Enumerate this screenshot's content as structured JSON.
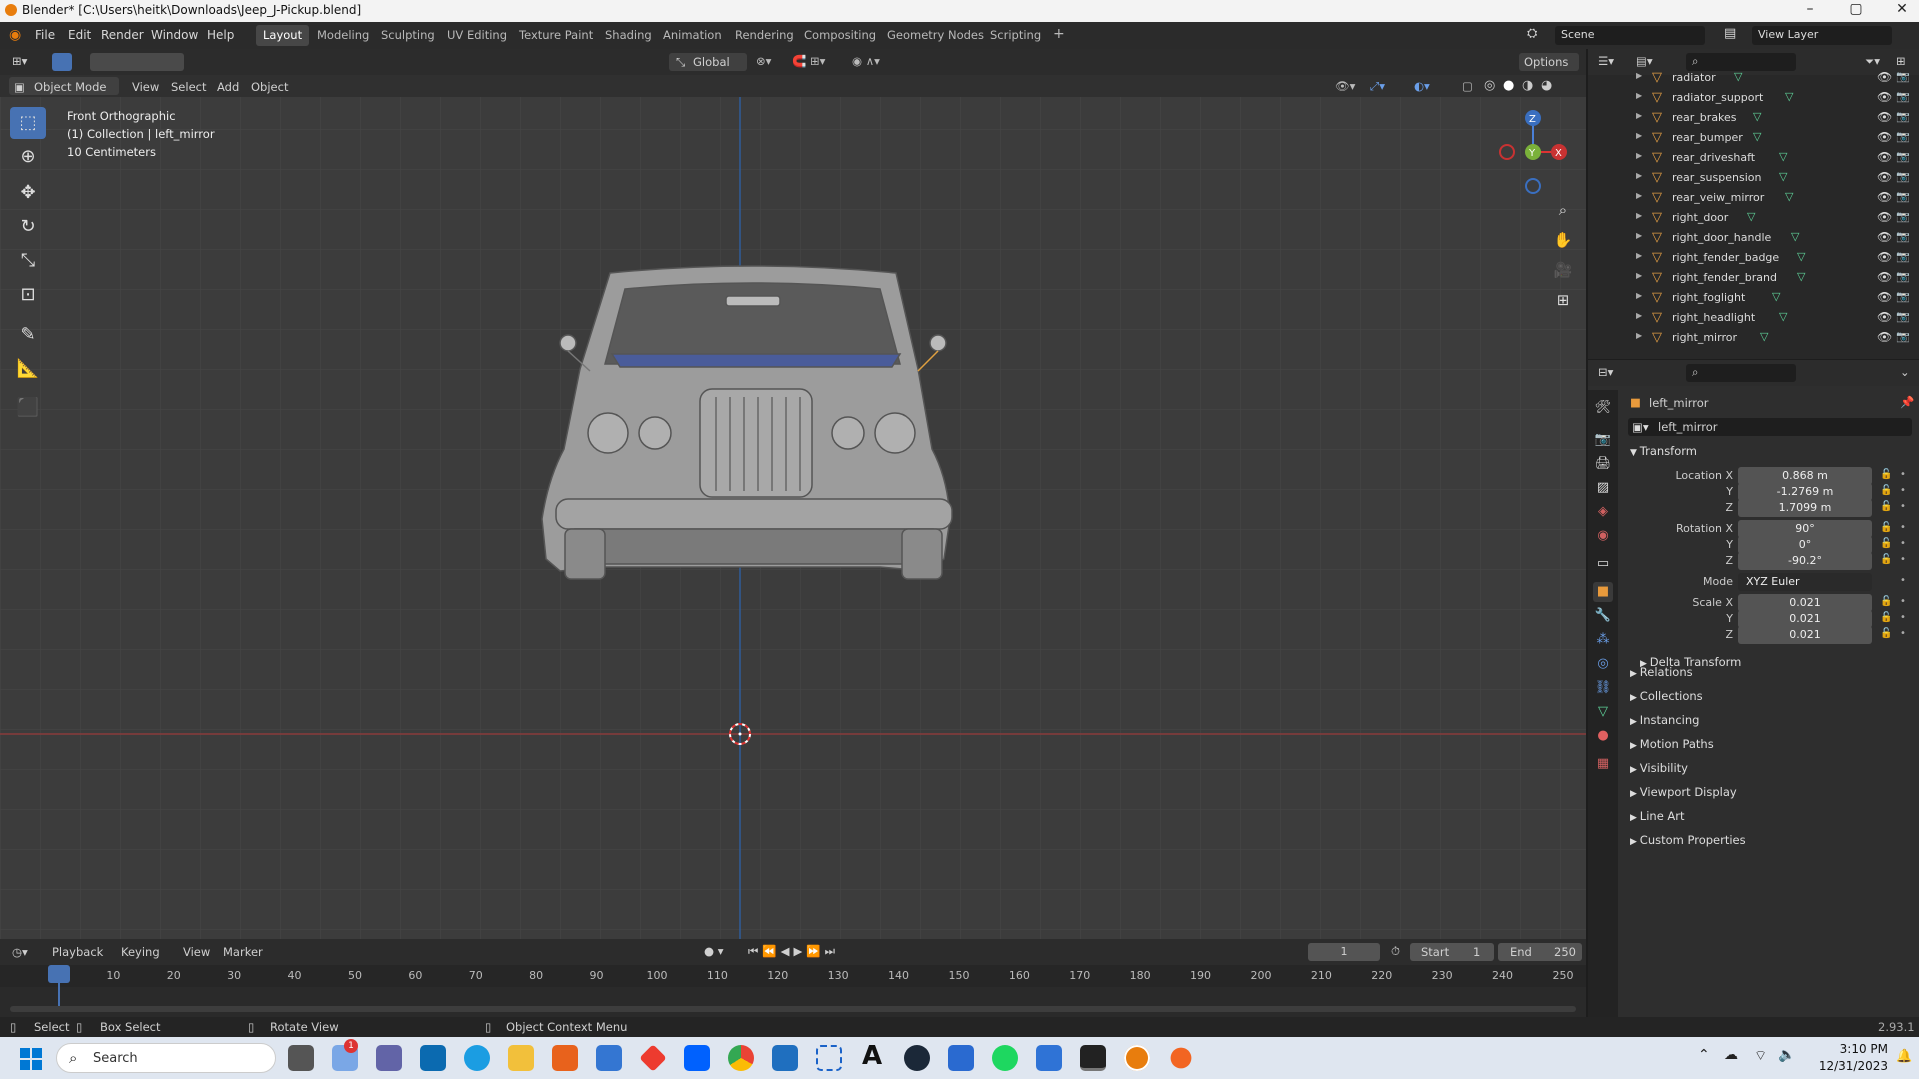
{
  "window": {
    "title": "Blender* [C:\\Users\\heitk\\Downloads\\Jeep_J-Pickup.blend]",
    "controls": [
      "–",
      "▢",
      "✕"
    ]
  },
  "menubar": {
    "menus": [
      "File",
      "Edit",
      "Render",
      "Window",
      "Help"
    ],
    "workspaces": [
      "Layout",
      "Modeling",
      "Sculpting",
      "UV Editing",
      "Texture Paint",
      "Shading",
      "Animation",
      "Rendering",
      "Compositing",
      "Geometry Nodes",
      "Scripting"
    ],
    "add_workspace": "+",
    "scene": "Scene",
    "view_layer": "View Layer"
  },
  "viewport": {
    "mode": "Object Mode",
    "menus": [
      "View",
      "Select",
      "Add",
      "Object"
    ],
    "orientation": "Global",
    "options": "Options",
    "overlay_lines": [
      "Front Orthographic",
      "(1) Collection | left_mirror",
      "10 Centimeters"
    ],
    "gizmo": {
      "z": "Z",
      "y": "Y",
      "x": "X"
    }
  },
  "outliner": {
    "items": [
      "radiator",
      "radiator_support",
      "rear_brakes",
      "rear_bumper",
      "rear_driveshaft",
      "rear_suspension",
      "rear_veiw_mirror",
      "right_door",
      "right_door_handle",
      "right_fender_badge",
      "right_fender_brand",
      "right_foglight",
      "right_headlight",
      "right_mirror"
    ]
  },
  "properties": {
    "object_name": "left_mirror",
    "datablock": "left_mirror",
    "transform_header": "Transform",
    "location_label": "Location X",
    "rotation_label": "Rotation X",
    "scale_label": "Scale X",
    "y_label": "Y",
    "z_label": "Z",
    "location": [
      "0.868 m",
      "-1.2769 m",
      "1.7099 m"
    ],
    "rotation": [
      "90°",
      "0°",
      "-90.2°"
    ],
    "mode_label": "Mode",
    "mode_value": "XYZ Euler",
    "scale": [
      "0.021",
      "0.021",
      "0.021"
    ],
    "delta": "Delta Transform",
    "sections": [
      "Relations",
      "Collections",
      "Instancing",
      "Motion Paths",
      "Visibility",
      "Viewport Display",
      "Line Art",
      "Custom Properties"
    ]
  },
  "timeline": {
    "menus": [
      "Playback",
      "Keying",
      "View",
      "Marker"
    ],
    "current_frame": "1",
    "start_label": "Start",
    "start": "1",
    "end_label": "End",
    "end": "250",
    "ticks": [
      "1",
      "10",
      "20",
      "30",
      "40",
      "50",
      "60",
      "70",
      "80",
      "90",
      "100",
      "110",
      "120",
      "130",
      "140",
      "150",
      "160",
      "170",
      "180",
      "190",
      "200",
      "210",
      "220",
      "230",
      "240",
      "250"
    ]
  },
  "statusbar": {
    "select": "Select",
    "box_select": "Box Select",
    "rotate": "Rotate View",
    "context": "Object Context Menu",
    "version": "2.93.1"
  },
  "taskbar": {
    "search": "Search",
    "time": "3:10 PM",
    "date": "12/31/2023",
    "badge": "1"
  }
}
